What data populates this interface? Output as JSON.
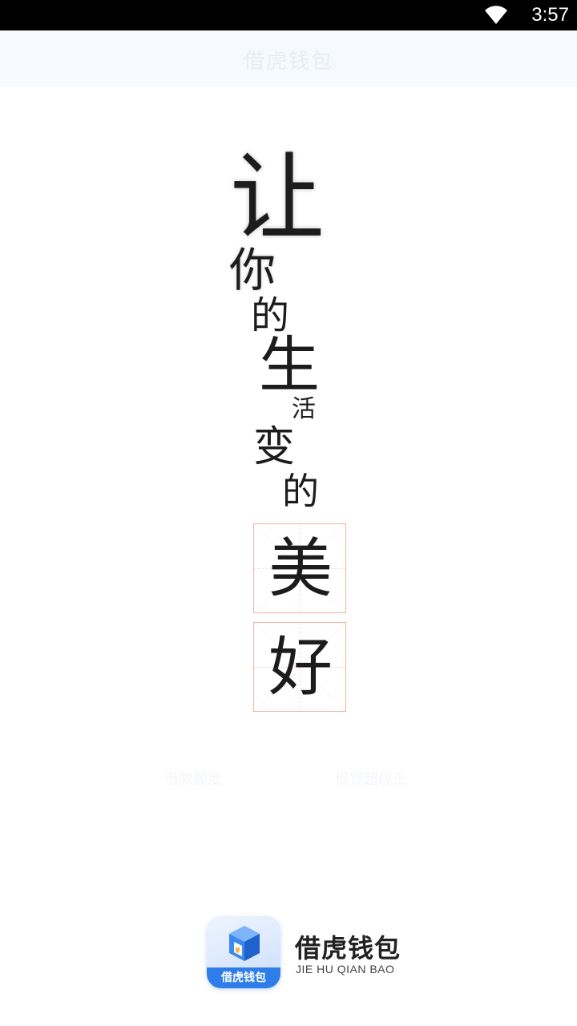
{
  "status_bar": {
    "time": "3:57",
    "icons": [
      "wifi-icon"
    ]
  },
  "title_bar": {
    "title": "借虎钱包"
  },
  "poem": {
    "chars": [
      "让",
      "你",
      "的",
      "生",
      "活",
      "变",
      "的"
    ],
    "grid_chars": [
      "美",
      "好"
    ]
  },
  "faint_text": {
    "left": "借款额度",
    "right": "借贷超级王"
  },
  "brand": {
    "icon_label": "借虎钱包",
    "name": "借虎钱包",
    "pinyin": "JIE HU QIAN BAO",
    "icon_name": "app-logo-icon",
    "colors": {
      "primary": "#2f7de8",
      "grid_border": "#f1b3a6"
    }
  }
}
